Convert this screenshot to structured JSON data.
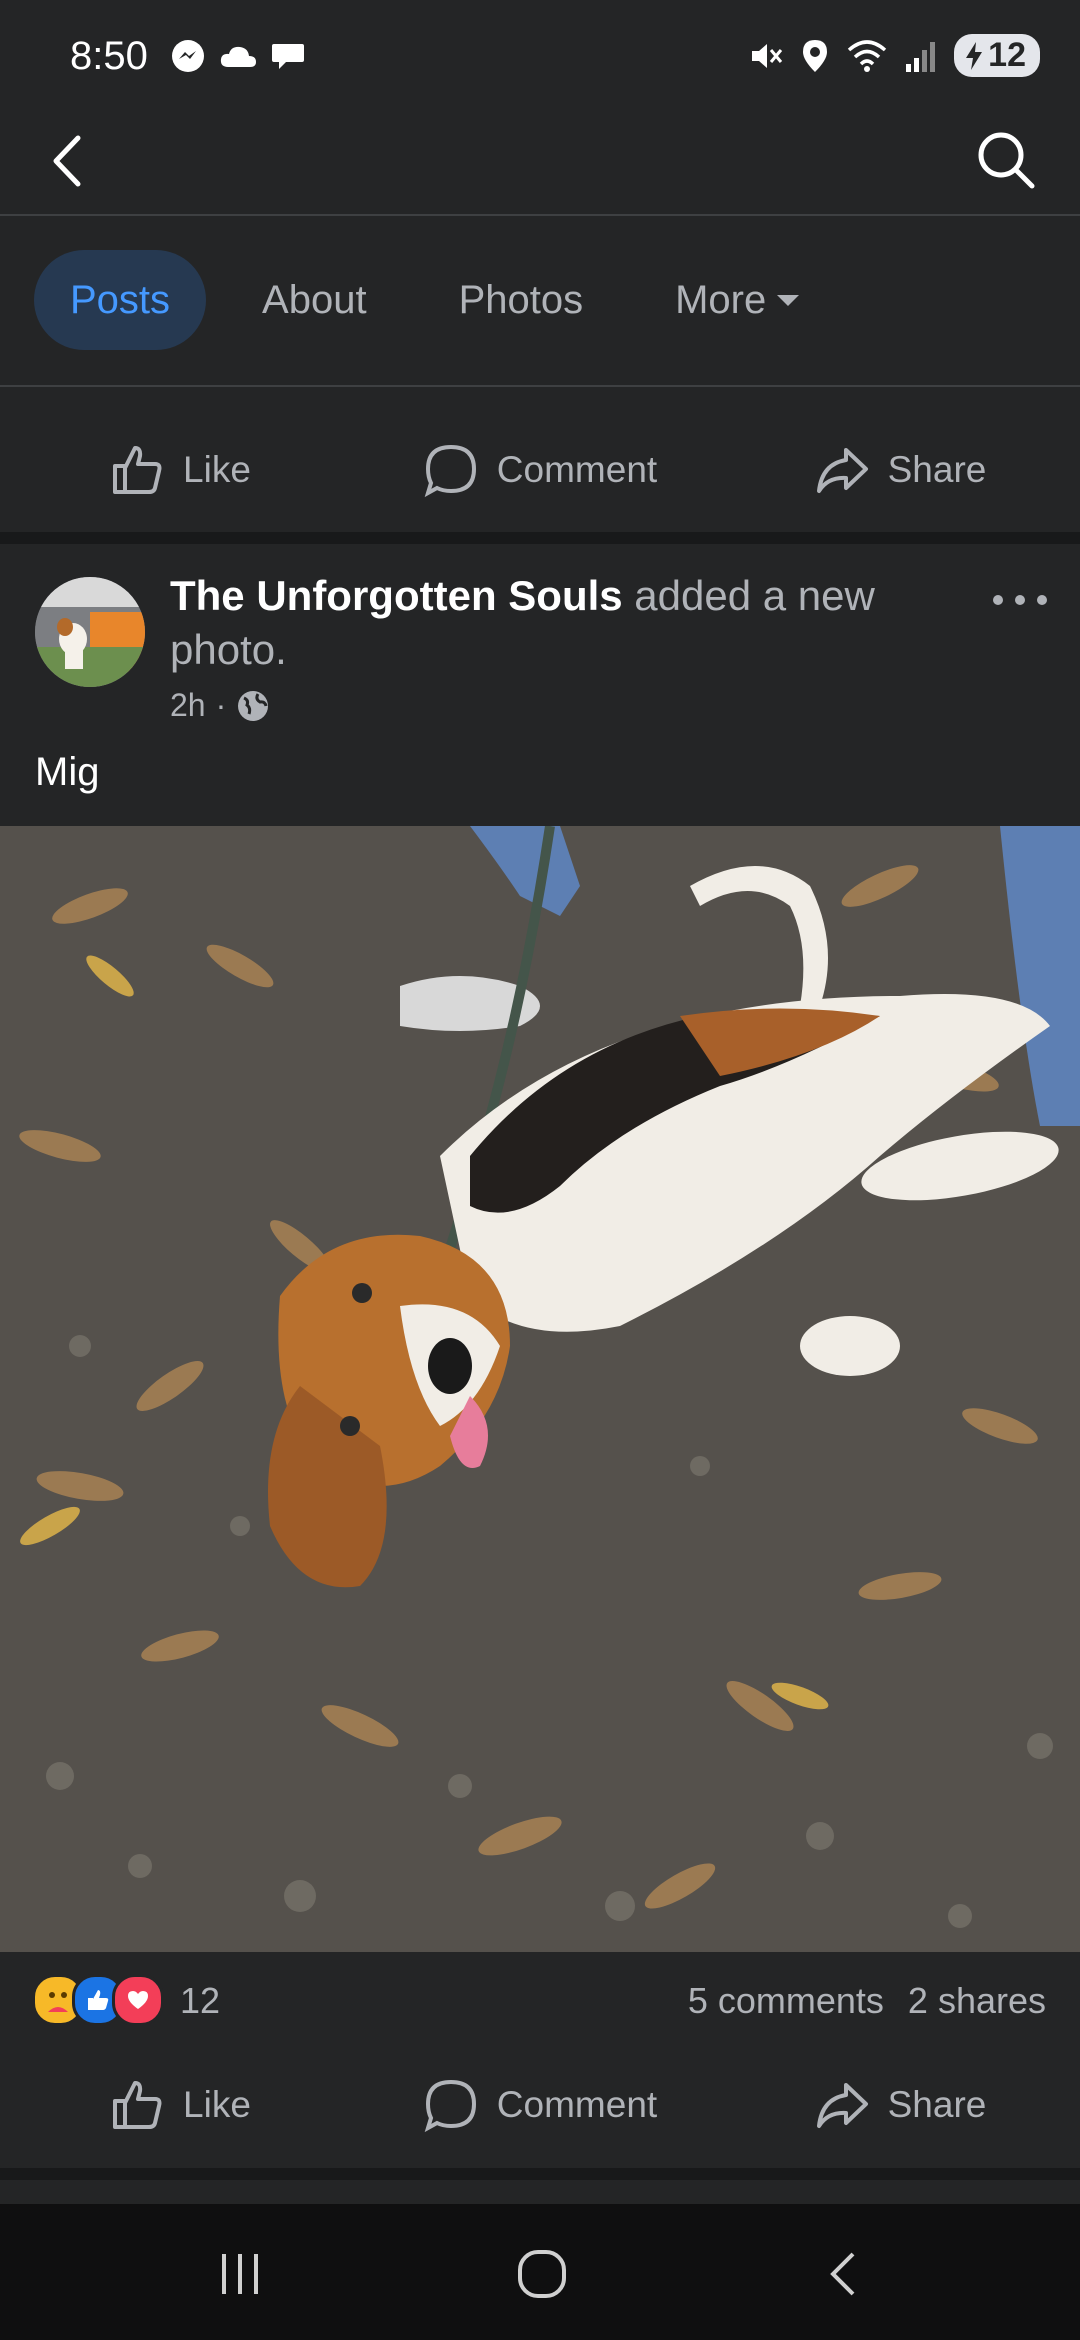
{
  "status": {
    "time": "8:50",
    "battery": "12"
  },
  "tabs": [
    {
      "label": "Posts",
      "active": true
    },
    {
      "label": "About"
    },
    {
      "label": "Photos"
    },
    {
      "label": "More"
    }
  ],
  "page_actions": {
    "like": "Like",
    "comment": "Comment",
    "share": "Share"
  },
  "post": {
    "author": "The Unforgotten Souls",
    "action_text": " added a new photo.",
    "time": "2h",
    "audience_icon": "globe-icon",
    "caption": "Mig",
    "reaction_count": "12",
    "comments": "5 comments",
    "shares": "2 shares",
    "reactions": [
      "care",
      "like",
      "love"
    ],
    "actions": {
      "like": "Like",
      "comment": "Comment",
      "share": "Share"
    }
  },
  "colors": {
    "background": "#242526",
    "accent": "#4599ff",
    "tab_active_bg": "#263951",
    "secondary_text": "#b0b3b8"
  }
}
